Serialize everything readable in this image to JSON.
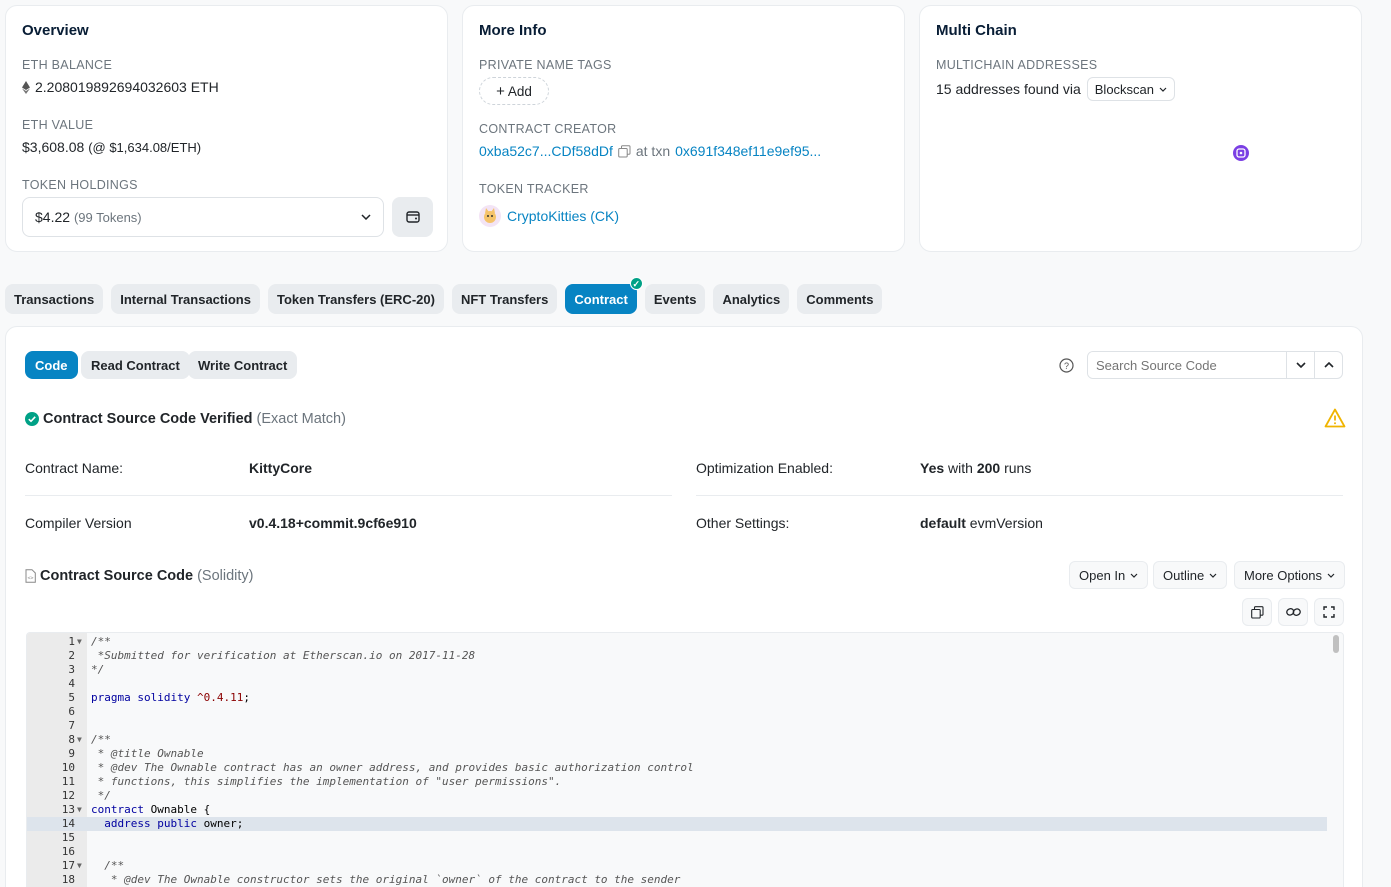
{
  "overview": {
    "title": "Overview",
    "eth_balance_label": "ETH BALANCE",
    "eth_balance_value": "2.208019892694032603 ETH",
    "eth_value_label": "ETH VALUE",
    "eth_value_amount": "$3,608.08",
    "eth_value_rate": "(@ $1,634.08/ETH)",
    "token_holdings_label": "TOKEN HOLDINGS",
    "token_holdings_value": "$4.22",
    "token_holdings_count": "(99 Tokens)"
  },
  "more_info": {
    "title": "More Info",
    "private_name_tags_label": "PRIVATE NAME TAGS",
    "add_label": "Add",
    "contract_creator_label": "CONTRACT CREATOR",
    "creator_address": "0xba52c7...CDf58dDf",
    "at_txn": "at txn",
    "txn_hash": "0x691f348ef11e9ef95...",
    "token_tracker_label": "TOKEN TRACKER",
    "token_tracker_value": "CryptoKitties (CK)"
  },
  "multi_chain": {
    "title": "Multi Chain",
    "addresses_label": "MULTICHAIN ADDRESSES",
    "addresses_text": "15 addresses found via",
    "provider": "Blockscan"
  },
  "tabs": [
    {
      "label": "Transactions"
    },
    {
      "label": "Internal Transactions"
    },
    {
      "label": "Token Transfers (ERC-20)"
    },
    {
      "label": "NFT Transfers"
    },
    {
      "label": "Contract"
    },
    {
      "label": "Events"
    },
    {
      "label": "Analytics"
    },
    {
      "label": "Comments"
    }
  ],
  "subtabs": [
    {
      "label": "Code"
    },
    {
      "label": "Read Contract"
    },
    {
      "label": "Write Contract"
    }
  ],
  "search": {
    "placeholder": "Search Source Code"
  },
  "verified": {
    "title": "Contract Source Code Verified",
    "match": "(Exact Match)"
  },
  "info": {
    "contract_name_label": "Contract Name:",
    "contract_name_value": "KittyCore",
    "compiler_label": "Compiler Version",
    "compiler_value": "v0.4.18+commit.9cf6e910",
    "optimization_label": "Optimization Enabled:",
    "optimization_yes": "Yes",
    "optimization_with": "with",
    "optimization_runs": "200",
    "optimization_runs_suffix": "runs",
    "other_settings_label": "Other Settings:",
    "other_settings_default": "default",
    "other_settings_evm": "evmVersion"
  },
  "source": {
    "title": "Contract Source Code",
    "lang": "(Solidity)",
    "open_in": "Open In",
    "outline": "Outline",
    "more_options": "More Options"
  },
  "code_lines": [
    {
      "n": "1",
      "t": "/**",
      "fold": true
    },
    {
      "n": "2",
      "t": " *Submitted for verification at Etherscan.io on 2017-11-28"
    },
    {
      "n": "3",
      "t": "*/"
    },
    {
      "n": "4",
      "t": ""
    },
    {
      "n": "5",
      "t": "pragma solidity ^0.4.11;"
    },
    {
      "n": "6",
      "t": ""
    },
    {
      "n": "7",
      "t": ""
    },
    {
      "n": "8",
      "t": "/**",
      "fold": true
    },
    {
      "n": "9",
      "t": " * @title Ownable"
    },
    {
      "n": "10",
      "t": " * @dev The Ownable contract has an owner address, and provides basic authorization control"
    },
    {
      "n": "11",
      "t": " * functions, this simplifies the implementation of \"user permissions\"."
    },
    {
      "n": "12",
      "t": " */"
    },
    {
      "n": "13",
      "t": "contract Ownable {",
      "fold": true
    },
    {
      "n": "14",
      "t": "  address public owner;"
    },
    {
      "n": "15",
      "t": ""
    },
    {
      "n": "16",
      "t": ""
    },
    {
      "n": "17",
      "t": "  /**",
      "fold": true
    },
    {
      "n": "18",
      "t": "   * @dev The Ownable constructor sets the original `owner` of the contract to the sender"
    }
  ]
}
